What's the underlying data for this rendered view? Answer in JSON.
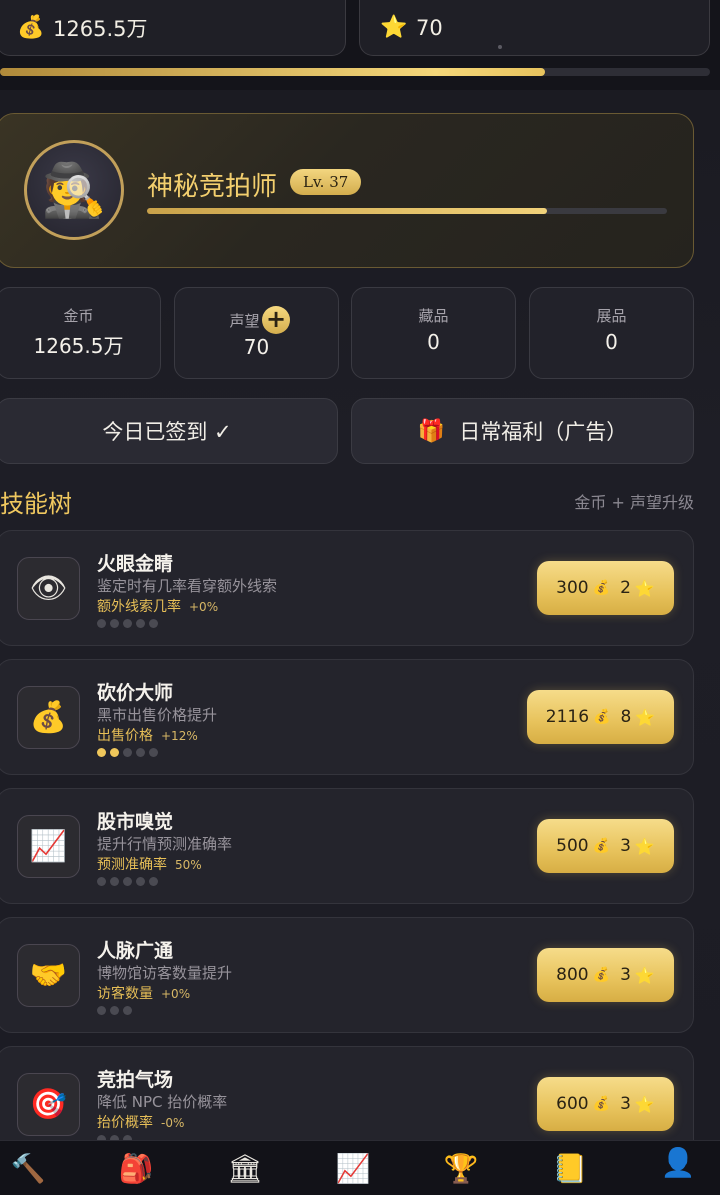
{
  "topbar": {
    "gold_icon": "money-bag-icon",
    "gold_value": "1265.5万",
    "fame_icon": "star-icon",
    "fame_value": "70",
    "xp_progress": 0.767
  },
  "profile": {
    "avatar_icon": "detective-icon",
    "name": "神秘竞拍师",
    "level": "Lv. 37",
    "level_progress": 0.77
  },
  "stats": [
    {
      "label": "金币",
      "value": "1265.5万"
    },
    {
      "label": "声望",
      "value": "70",
      "plus": "+"
    },
    {
      "label": "藏品",
      "value": "0"
    },
    {
      "label": "展品",
      "value": "0"
    }
  ],
  "actions": {
    "checkin_label": "今日已签到 ✓",
    "daily_label": "日常福利（广告）",
    "daily_icon": "gift-icon"
  },
  "skill_tree": {
    "title": "技能树",
    "hint": "金币 + 声望升级",
    "skills": [
      {
        "name": "火眼金睛",
        "desc": "鉴定时有几率看穿额外线索",
        "stat": "额外线索几率",
        "stat_value": "+0%",
        "pips_total": 5,
        "pips_on": 0,
        "gold_cost": "300",
        "fame_cost": "2",
        "icon": "eye-icon"
      },
      {
        "name": "砍价大师",
        "desc": "黑市出售价格提升",
        "stat": "出售价格",
        "stat_value": "+12%",
        "pips_total": 5,
        "pips_on": 2,
        "gold_cost": "2116",
        "fame_cost": "8",
        "icon": "money-bag-icon"
      },
      {
        "name": "股市嗅觉",
        "desc": "提升行情预测准确率",
        "stat": "预测准确率",
        "stat_value": "50%",
        "pips_total": 5,
        "pips_on": 0,
        "gold_cost": "500",
        "fame_cost": "3",
        "icon": "chart-increasing-icon"
      },
      {
        "name": "人脉广通",
        "desc": "博物馆访客数量提升",
        "stat": "访客数量",
        "stat_value": "+0%",
        "pips_total": 3,
        "pips_on": 0,
        "gold_cost": "800",
        "fame_cost": "3",
        "icon": "handshake-icon"
      },
      {
        "name": "竞拍气场",
        "desc": "降低 NPC 抬价概率",
        "stat": "抬价概率",
        "stat_value": "-0%",
        "pips_total": 3,
        "pips_on": 0,
        "gold_cost": "600",
        "fame_cost": "3",
        "icon": "target-icon"
      }
    ]
  },
  "bottom_nav": [
    {
      "icon": "hammer-icon",
      "glyph": "🔨"
    },
    {
      "icon": "backpack-icon",
      "glyph": "🎒"
    },
    {
      "icon": "museum-icon",
      "glyph": "🏛"
    },
    {
      "icon": "chart-increasing-icon",
      "glyph": "📈"
    },
    {
      "icon": "trophy-icon",
      "glyph": "🏆"
    },
    {
      "icon": "ledger-icon",
      "glyph": "📒"
    },
    {
      "icon": "user-icon",
      "glyph": "👤",
      "active": true
    }
  ]
}
